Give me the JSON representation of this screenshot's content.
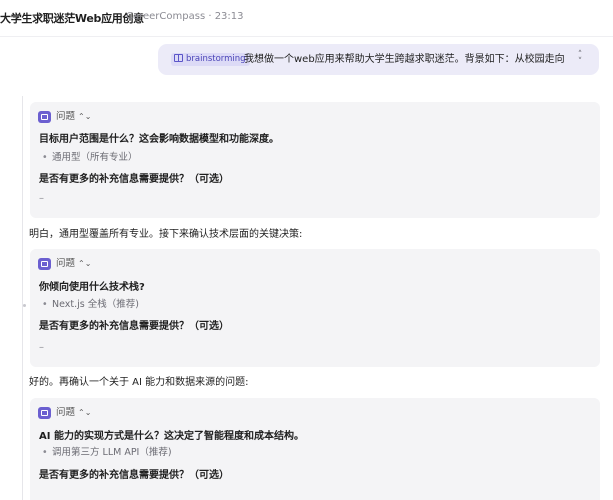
{
  "header": {
    "title": "大学生求职迷茫Web应用创意",
    "meta": "CareerCompass · 23:13"
  },
  "user_message": {
    "tag": "brainstorming",
    "text": "我想做一个web应用来帮助大学生跨越求职迷茫。背景如下：从校园走向职场，"
  },
  "cards": [
    {
      "label": "问题",
      "question": "目标用户范围是什么？这会影响数据模型和功能深度。",
      "answer": "通用型（所有专业）",
      "followup": "是否有更多的补充信息需要提供？（可选）",
      "followup_answer": "–"
    },
    {
      "label": "问题",
      "question": "你倾向使用什么技术栈?",
      "answer": "Next.js 全栈（推荐)",
      "followup": "是否有更多的补充信息需要提供？（可选）",
      "followup_answer": "–"
    },
    {
      "label": "问题",
      "question": "AI 能力的实现方式是什么？这决定了智能程度和成本结构。",
      "answer": "调用第三方 LLM API（推荐)",
      "followup": "是否有更多的补充信息需要提供？（可选）"
    }
  ],
  "messages": [
    "明白，通用型覆盖所有专业。接下来确认技术层面的关键决策:",
    "好的。再确认一个关于 AI 能力和数据来源的问题:"
  ],
  "colors": {
    "accent": "#6b5fd0",
    "bubble": "#ecebf8",
    "card": "#f4f4f6"
  }
}
